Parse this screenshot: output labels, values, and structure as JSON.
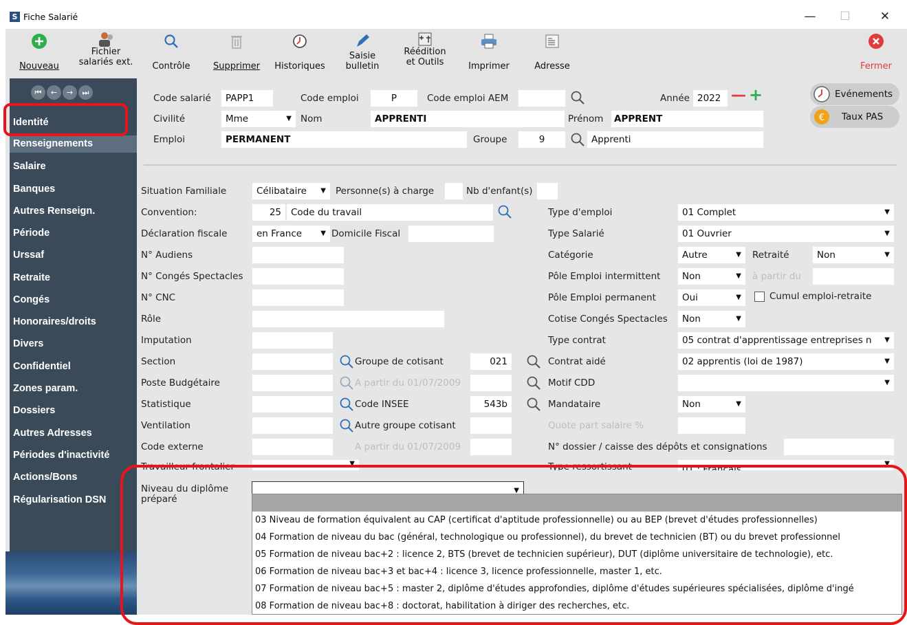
{
  "window": {
    "title": "Fiche Salarié",
    "logo": "S",
    "minimize": "—",
    "maximize": "☐",
    "close": "✕"
  },
  "toolbar": {
    "nouveau": "Nouveau",
    "fichier1": "Fichier",
    "fichier2": "salariés ext.",
    "controle": "Contrôle",
    "supprimer": "Supprimer",
    "historiques": "Historiques",
    "saisie1": "Saisie",
    "saisie2": "bulletin",
    "reedition1": "Réédition",
    "reedition2": "et Outils",
    "imprimer": "Imprimer",
    "adresse": "Adresse",
    "fermer": "Fermer"
  },
  "sidebar": {
    "items": [
      "Identité",
      "Renseignements",
      "Salaire",
      "Banques",
      "Autres Renseign.",
      "Période",
      "Urssaf",
      "Retraite",
      "Congés",
      "Honoraires/droits",
      "Divers",
      "Confidentiel",
      "Zones param.",
      "Dossiers",
      "Autres Adresses",
      "Périodes d'inactivité",
      "Actions/Bons",
      "Régularisation DSN"
    ]
  },
  "header": {
    "code_salarie_label": "Code salarié",
    "code_salarie": "PAPP1",
    "code_emploi_label": "Code emploi",
    "code_emploi": "P",
    "code_emploi_aem_label": "Code emploi AEM",
    "code_emploi_aem": "",
    "annee_label": "Année",
    "annee": "2022",
    "minus": "—",
    "plus": "+",
    "civilite_label": "Civilité",
    "civilite": "Mme",
    "nom_label": "Nom",
    "nom": "APPRENTI",
    "prenom_label": "Prénom",
    "prenom": "APPRENT",
    "emploi_label": "Emploi",
    "emploi": "PERMANENT",
    "groupe_label": "Groupe",
    "groupe": "9",
    "groupe_name": "Apprenti",
    "evenements": "Evénements",
    "taux_pas": "Taux PAS"
  },
  "form": {
    "situation_label": "Situation Familiale",
    "situation": "Célibataire",
    "personnes_label": "Personne(s) à charge",
    "personnes": "",
    "enfants_label": "Nb d'enfant(s)",
    "enfants": "",
    "convention_label": "Convention:",
    "convention_num": "25",
    "convention": "Code du travail",
    "declaration_label": "Déclaration fiscale",
    "declaration": "en France",
    "domicile_label": "Domicile Fiscal",
    "domicile": "",
    "audiens_label": "N° Audiens",
    "conges_spec_label": "N° Congés Spectacles",
    "cnc_label": "N° CNC",
    "role_label": "Rôle",
    "imputation_label": "Imputation",
    "section_label": "Section",
    "poste_label": "Poste Budgétaire",
    "statistique_label": "Statistique",
    "ventilation_label": "Ventilation",
    "code_externe_label": "Code externe",
    "travailleur_label": "Travailleur frontalier",
    "groupe_cotisant_label": "Groupe de cotisant",
    "groupe_cotisant": "021",
    "a_partir_label": "A partir du 01/07/2009",
    "code_insee_label": "Code INSEE",
    "code_insee": "543b",
    "autre_groupe_label": "Autre groupe cotisant",
    "a_partir2_label": "A partir du 01/07/2009",
    "type_emploi_label": "Type d'emploi",
    "type_emploi": "01 Complet",
    "type_salarie_label": "Type Salarié",
    "type_salarie": "01 Ouvrier",
    "categorie_label": "Catégorie",
    "categorie": "Autre",
    "retraite_label": "Retraité",
    "retraite": "Non",
    "pole_inter_label": "Pôle Emploi intermittent",
    "pole_inter": "Non",
    "partir_du_label": "à partir du",
    "pole_perm_label": "Pôle Emploi permanent",
    "pole_perm": "Oui",
    "cumul_label": "Cumul emploi-retraite",
    "cotise_label": "Cotise Congés Spectacles",
    "cotise": "Non",
    "type_contrat_label": "Type contrat",
    "type_contrat": "05 contrat d'apprentissage entreprises n",
    "contrat_aide_label": "Contrat aidé",
    "contrat_aide": "02 apprentis (loi de 1987)",
    "motif_cdd_label": "Motif CDD",
    "motif_cdd": "",
    "mandataire_label": "Mandataire",
    "mandataire": "Non",
    "quote_part_label": "Quote part salaire  %",
    "dossier_label": "N° dossier / caisse des dépôts et consignations",
    "type_ress_label": "Type ressortissant",
    "type_ress": "01 : Français",
    "niveau_label1": "Niveau du diplôme",
    "niveau_label2": "préparé",
    "niveau": ""
  },
  "dropdown": {
    "options": [
      "03 Niveau de formation équivalent au CAP (certificat d'aptitude professionnelle) ou au BEP (brevet d'études professionnelles)",
      "04 Formation de niveau du bac (général, technologique ou professionnel), du brevet de technicien (BT) ou du brevet professionnel",
      "05 Formation de niveau bac+2 : licence 2, BTS (brevet de technicien supérieur), DUT (diplôme universitaire de technologie), etc.",
      "06 Formation de niveau bac+3 et bac+4 : licence 3, licence professionnelle, master 1, etc.",
      "07 Formation de niveau bac+5 : master 2, diplôme d'études approfondies, diplôme d'études supérieures spécialisées, diplôme d'ingé",
      "08 Formation de niveau bac+8 : doctorat, habilitation à diriger des recherches, etc."
    ]
  },
  "colors": {
    "sidebar": "#3b4a59",
    "selected": "#5d6e80",
    "highlight": "#e8141c",
    "close_red": "#e23b3b",
    "green": "#2fae4e"
  }
}
